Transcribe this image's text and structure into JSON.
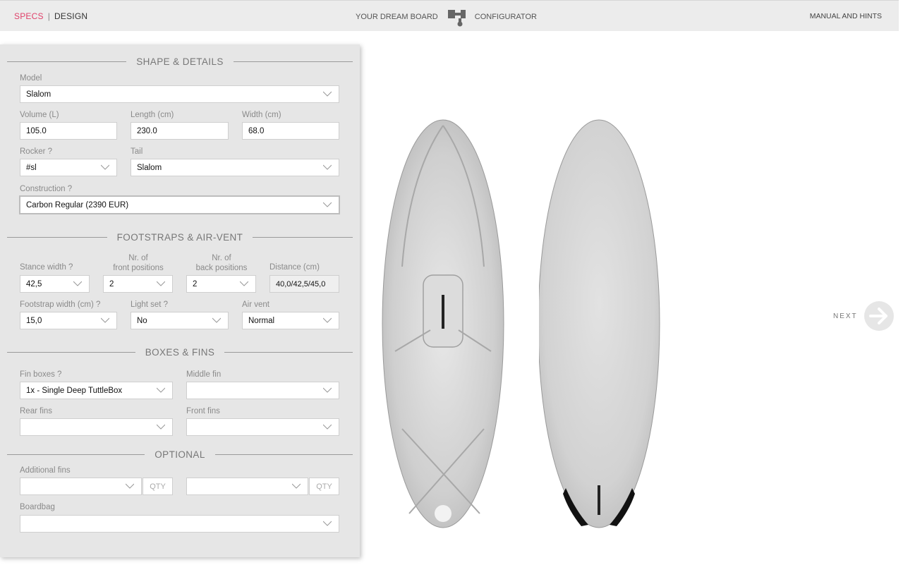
{
  "header": {
    "tab_specs": "SPECS",
    "separator": "|",
    "tab_design": "DESIGN",
    "center_left": "YOUR DREAM BOARD",
    "center_right": "CONFIGURATOR",
    "manual_link": "MANUAL AND HINTS",
    "accent_color": "#e0416a"
  },
  "shape": {
    "heading": "SHAPE & DETAILS",
    "model_label": "Model",
    "model_value": "Slalom",
    "volume_label": "Volume (L)",
    "volume_value": "105.0",
    "length_label": "Length (cm)",
    "length_value": "230.0",
    "width_label": "Width (cm)",
    "width_value": "68.0",
    "rocker_label": "Rocker ?",
    "rocker_value": "#sl",
    "tail_label": "Tail",
    "tail_value": "Slalom",
    "construction_label": "Construction ?",
    "construction_value": "Carbon Regular (2390 EUR)"
  },
  "straps": {
    "heading": "FOOTSTRAPS & AIR-VENT",
    "stance_label": "Stance width ?",
    "stance_value": "42,5",
    "front_label_1": "Nr. of",
    "front_label_2": "front positions",
    "front_value": "2",
    "back_label_1": "Nr. of",
    "back_label_2": "back positions",
    "back_value": "2",
    "distance_label": "Distance (cm)",
    "distance_value": "40,0/42,5/45,0",
    "strap_width_label": "Footstrap width (cm) ?",
    "strap_width_value": "15,0",
    "light_label": "Light set ?",
    "light_value": "No",
    "airvent_label": "Air vent",
    "airvent_value": "Normal"
  },
  "fins": {
    "heading": "BOXES & FINS",
    "finboxes_label": "Fin boxes ?",
    "finboxes_value": "1x - Single Deep TuttleBox",
    "middle_label": "Middle fin",
    "middle_value": "",
    "rear_label": "Rear fins",
    "rear_value": "",
    "front_label": "Front fins",
    "front_value": ""
  },
  "optional": {
    "heading": "OPTIONAL",
    "additional_label": "Additional fins",
    "additional1_value": "",
    "qty1": "QTY",
    "additional2_value": "",
    "qty2": "QTY",
    "boardbag_label": "Boardbag",
    "boardbag_value": ""
  },
  "nav": {
    "next_label": "NEXT"
  }
}
